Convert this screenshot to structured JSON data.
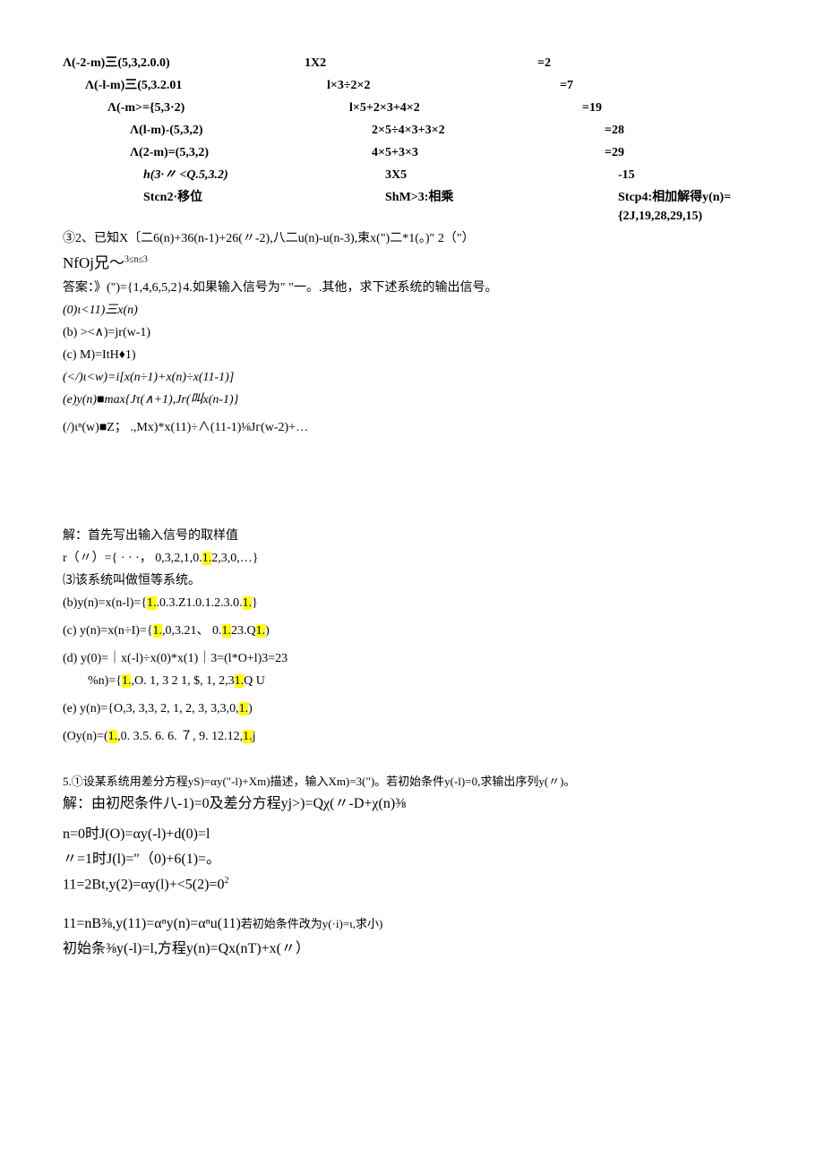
{
  "table": {
    "rows": [
      {
        "c1": "Λ(-2-m)三(5,3,2.0.0)",
        "c2": "1X2",
        "c3": "=2",
        "indent": ""
      },
      {
        "c1": "Λ(-l-m)三(5,3.2.01",
        "c2": "l×3÷2×2",
        "c3": "=7",
        "indent": "indent1"
      },
      {
        "c1": "Λ(-m>={5,3·2)",
        "c2": "l×5+2×3+4×2",
        "c3": "=19",
        "indent": "indent2"
      },
      {
        "c1": "Λ(l-m)-(5,3,2)",
        "c2": "2×5÷4×3+3×2",
        "c3": "=28",
        "indent": "indent3"
      },
      {
        "c1": "Λ(2-m)=(5,3,2)",
        "c2": "4×5+3×3",
        "c3": "=29",
        "indent": "indent3"
      },
      {
        "c1": "h(3·〃 <Q.5,3.2)",
        "c2": "3X5",
        "c3": "-15",
        "indent": "indent4",
        "italic": true
      },
      {
        "c1": "Stcn2·移位",
        "c2": "ShM>3:相乘",
        "c3": "Stcp4:相加解得y(n)={2J,19,28,29,15)",
        "indent": "indent4"
      }
    ]
  },
  "line_32": "③2、已知X〔二6(n)+36(n-1)+26(〃-2),八二u(n)-u(n-3),束x(\")二*1(。)″ 2（\"）",
  "line_nfoj": "NfOj兄～",
  "line_nfoj_sup": "3≤n≤3",
  "line_ans": "答案：》(\")={1,4,6,5,2}4.如果输入信号为″ ″一。.其他，求下述系统的输出信号。",
  "line_0": "(0)ι<11)三x(n)",
  "line_b": "(b)  ><∧)=jr(w-1)",
  "line_c": "(c)  M)=ItH♦1)",
  "line_diamond": "(</)ι<w)=i[x(n÷1)+x(n)÷x(11-1)]",
  "line_e": "(e)y(n)■max{Jτ(∧+1),Jr(叫x(n-1)}",
  "line_f": "(/)ιⁿ(w)■Z； .,Mx)*x(11)÷∧(11-1)⅛Jг(w-2)+…",
  "sol_header": "解：首先写出输入信号的取样值",
  "line_r": {
    "pre": "r（〃）={ · · ·， 0,3,2,1,0.",
    "hl": "1.",
    "post": "2,3,0,…}"
  },
  "line_3": "⑶该系统叫做恒等系统。",
  "line_by": {
    "pre": "(b)y(n)=x(n-l)={",
    "hl1": "1.",
    "mid": ".0.3.Z1.0.1.2.3.0.",
    "hl2": "1.",
    "post": "}"
  },
  "line_cy": {
    "pre": "(c)  y(n)=x(n÷I)={",
    "hl1": "1.",
    "mid1": ",0,3.21、 0.",
    "hl2": "1.",
    "mid2": "23.Q",
    "hl3": "1.",
    "post": ")"
  },
  "line_d1": "(d)  y(0)=｜x(-l)÷x(0)*x(1)｜3=(l*O+l)3=23",
  "line_d2": {
    "pre": "%n)={",
    "hl1": "1.",
    "mid": ",O.      1, 3  2  1,  $,   1,         2,3",
    "hl2": "1.",
    "post": "Q   U"
  },
  "line_ey": {
    "pre": "(e)  y(n)={O,3,      3,3,  2,  1,  2,   3,        3,3,0,",
    "hl": "1.",
    "post": ")"
  },
  "line_oy": {
    "pre": "(Oy(n)=(",
    "hl1": "1.",
    "mid": ",0.        3.5.  6.  6.  ７,  9.        12.12,",
    "hl2": "1.",
    "post": "j"
  },
  "line_5": "5.①设某系统用差分方程yS)=αy(\"-l)+Xm)描述，输入Xm)=3(\")。若初始条件y(-l)=0,求输出序列y(〃)。",
  "line_sol2": "解：由初咫条件八-1)=0及差分方程yj>)=Qχ(〃-D+χ(n)⅜",
  "line_n0": "n=0时J(O)=αy(-l)+d(0)=l",
  "line_n1": "〃=1时J(l)=″（0)+6(1)=。",
  "line_n2_pre": "11=2Bt,y(2)=αy(l)+<5(2)=0",
  "line_n2_sup": "2",
  "line_nn": "11=nB⅜,y(11)=αⁿy(n)=αⁿu(11)",
  "line_nn_post": "若初始条件改为y(·i)=ι,求小)",
  "line_last": "初始条⅜y(-l)=l,方程y(n)=Qx(nT)+x(〃）"
}
